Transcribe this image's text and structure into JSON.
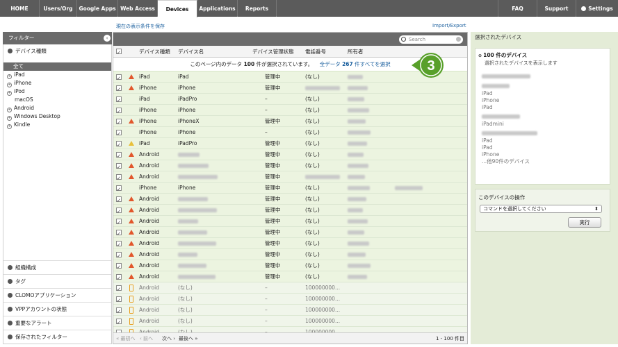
{
  "nav": {
    "tabs": [
      "HOME",
      "Users/Org",
      "Google Apps",
      "Web Access",
      "Devices",
      "Applications",
      "Reports"
    ],
    "active": "Devices",
    "right": [
      "FAQ",
      "Support",
      "Settings"
    ]
  },
  "toolbar": {
    "save_filter": "現在の表示条件を保存",
    "import_export": "Import/Export"
  },
  "filter": {
    "title": "フィルター",
    "device_type_section": "デバイス種類",
    "tree": [
      {
        "label": "全て",
        "selected": true,
        "expandable": false
      },
      {
        "label": "iPad",
        "expandable": true
      },
      {
        "label": "iPhone",
        "expandable": true
      },
      {
        "label": "iPod",
        "expandable": true
      },
      {
        "label": "macOS",
        "expandable": false
      },
      {
        "label": "Android",
        "expandable": true
      },
      {
        "label": "Windows Desktop",
        "expandable": true
      },
      {
        "label": "Kindle",
        "expandable": true
      }
    ],
    "bottom_sections": [
      "組織構成",
      "タグ",
      "CLOMOアプリケーション",
      "VPPアカウントの状態",
      "重要なアラート",
      "保存されたフィルター"
    ]
  },
  "table": {
    "search_placeholder": "Search",
    "headers": [
      "デバイス種類",
      "デバイス名",
      "デバイス管理状態",
      "電話番号",
      "所有者"
    ],
    "banner": {
      "prefix": "このページ内のデータ",
      "count": "100",
      "suffix": "件が選択されています。",
      "select_all": "全データ",
      "total": "267",
      "select_all_suffix": "件すべてを選択"
    },
    "rows": [
      {
        "warn": "red",
        "type": "iPad",
        "name": "iPad",
        "status": "管理中",
        "phone": "(なし)"
      },
      {
        "warn": "red",
        "type": "iPhone",
        "name": "iPhone",
        "status": "管理中",
        "phone": ""
      },
      {
        "warn": "",
        "type": "iPad",
        "name": "iPadPro",
        "status": "–",
        "phone": "(なし)"
      },
      {
        "warn": "",
        "type": "iPhone",
        "name": "iPhone",
        "status": "–",
        "phone": "(なし)"
      },
      {
        "warn": "red",
        "type": "iPhone",
        "name": "iPhoneX",
        "status": "管理中",
        "phone": "(なし)"
      },
      {
        "warn": "",
        "type": "iPhone",
        "name": "iPhone",
        "status": "–",
        "phone": "(なし)"
      },
      {
        "warn": "yellow",
        "type": "iPad",
        "name": "iPadPro",
        "status": "管理中",
        "phone": "(なし)"
      },
      {
        "warn": "red",
        "type": "Android",
        "name": "",
        "status": "管理中",
        "phone": "(なし)"
      },
      {
        "warn": "red",
        "type": "Android",
        "name": "",
        "status": "管理中",
        "phone": "(なし)"
      },
      {
        "warn": "red",
        "type": "Android",
        "name": "",
        "status": "管理中",
        "phone": ""
      },
      {
        "warn": "",
        "type": "iPhone",
        "name": "iPhone",
        "status": "管理中",
        "phone": "(なし)"
      },
      {
        "warn": "red",
        "type": "Android",
        "name": "",
        "status": "管理中",
        "phone": "(なし)"
      },
      {
        "warn": "red",
        "type": "Android",
        "name": "",
        "status": "管理中",
        "phone": "(なし)"
      },
      {
        "warn": "red",
        "type": "Android",
        "name": "",
        "status": "管理中",
        "phone": "(なし)"
      },
      {
        "warn": "red",
        "type": "Android",
        "name": "",
        "status": "管理中",
        "phone": "(なし)"
      },
      {
        "warn": "red",
        "type": "Android",
        "name": "",
        "status": "管理中",
        "phone": "(なし)"
      },
      {
        "warn": "red",
        "type": "Android",
        "name": "",
        "status": "管理中",
        "phone": "(なし)"
      },
      {
        "warn": "red",
        "type": "Android",
        "name": "",
        "status": "管理中",
        "phone": "(なし)"
      },
      {
        "warn": "red",
        "type": "Android",
        "name": "",
        "status": "管理中",
        "phone": "(なし)"
      },
      {
        "warn": "phone",
        "type": "Android",
        "name": "(なし)",
        "status": "–",
        "phone": "100000000..."
      },
      {
        "warn": "phone",
        "type": "Android",
        "name": "(なし)",
        "status": "–",
        "phone": "100000000..."
      },
      {
        "warn": "phone",
        "type": "Android",
        "name": "(なし)",
        "status": "–",
        "phone": "100000000..."
      },
      {
        "warn": "phone",
        "type": "Android",
        "name": "(なし)",
        "status": "–",
        "phone": "100000000..."
      },
      {
        "warn": "phone",
        "type": "Android",
        "name": "(なし)",
        "status": "–",
        "phone": "100000000..."
      }
    ],
    "footer": {
      "first": "最初へ",
      "prev": "前へ",
      "next": "次へ",
      "last": "最後へ",
      "range": "1 - 100 件目"
    }
  },
  "selected": {
    "title": "選択されたデバイス",
    "count_label": "100 件のデバイス",
    "show_link": "選択されたデバイスを表示します",
    "list": [
      "iPad",
      "iPhone",
      "iPad",
      "iPadmini",
      "iPad",
      "iPad",
      "iPhone"
    ],
    "more": "...他90件のデバイス",
    "op_title": "このデバイスの操作",
    "op_placeholder": "コマンドを選択してください",
    "run": "実行"
  },
  "step_badge": "3"
}
